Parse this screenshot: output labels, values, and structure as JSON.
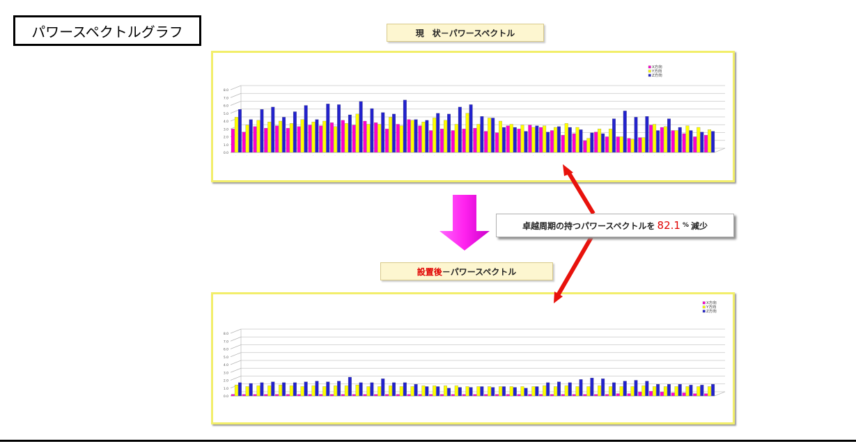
{
  "page": {
    "title": "パワースペクトルグラフ"
  },
  "top_chart": {
    "label": "現　状－パワースペクトル"
  },
  "bottom_chart": {
    "label_highlight": "設置後",
    "label_rest": "－パワースペクトル"
  },
  "callout": {
    "prefix": "卓越周期の持つパワースペクトルを",
    "value": "82.1",
    "percent": "%",
    "suffix": "減少"
  },
  "colors": {
    "x_series": "#ff00cc",
    "y_series": "#ffff00",
    "z_series": "#2222cc",
    "down_arrow": "#ff33ff",
    "red_arrow": "#e8120c",
    "frame_border": "#f2ee6a"
  },
  "chart_data": [
    {
      "type": "bar",
      "ylim": [
        0,
        8
      ],
      "yticks": [
        "0.0",
        "1.0",
        "2.0",
        "3.0",
        "4.0",
        "5.0",
        "6.0",
        "7.0",
        "8.0"
      ],
      "legend_position": "top-right",
      "series": [
        {
          "name": "X方向",
          "color": "#ff00cc",
          "values": [
            3.0,
            2.6,
            3.3,
            3.1,
            3.4,
            3.1,
            3.3,
            3.5,
            3.4,
            3.8,
            4.1,
            3.5,
            4.0,
            3.8,
            3.0,
            3.6,
            4.2,
            3.4,
            2.8,
            3.0,
            2.8,
            3.0,
            3.1,
            2.7,
            2.5,
            3.4,
            3.0,
            3.5,
            3.2,
            2.8,
            2.2,
            2.4,
            1.5,
            2.6,
            2.0,
            2.0,
            1.8,
            1.9,
            3.5,
            3.2,
            2.8,
            2.4,
            2.0,
            2.2
          ]
        },
        {
          "name": "Y方向",
          "color": "#ffff00",
          "values": [
            4.5,
            3.5,
            4.1,
            3.9,
            4.0,
            3.7,
            4.2,
            3.9,
            4.0,
            3.3,
            3.7,
            4.9,
            3.6,
            3.6,
            4.5,
            3.4,
            4.1,
            3.9,
            4.4,
            4.1,
            3.6,
            5.0,
            3.6,
            4.4,
            4.0,
            3.6,
            3.5,
            3.2,
            3.4,
            3.2,
            3.7,
            3.2,
            1.8,
            3.0,
            3.0,
            2.0,
            1.7,
            1.9,
            3.6,
            3.3,
            2.8,
            3.4,
            3.2,
            2.9
          ]
        },
        {
          "name": "Z方向",
          "color": "#2222cc",
          "values": [
            5.5,
            4.2,
            5.5,
            5.8,
            4.5,
            5.2,
            6.0,
            4.2,
            6.2,
            6.1,
            4.8,
            6.5,
            5.6,
            5.1,
            4.9,
            6.7,
            4.2,
            4.1,
            5.0,
            4.9,
            5.8,
            6.1,
            4.6,
            4.4,
            3.2,
            3.2,
            2.7,
            3.4,
            2.6,
            3.3,
            3.2,
            2.9,
            2.5,
            2.4,
            4.3,
            5.3,
            4.5,
            4.6,
            2.8,
            4.3,
            3.2,
            2.8,
            2.6,
            2.7
          ]
        }
      ]
    },
    {
      "type": "bar",
      "ylim": [
        0,
        8
      ],
      "yticks": [
        "0.0",
        "1.0",
        "2.0",
        "3.0",
        "4.0",
        "5.0",
        "6.0",
        "7.0",
        "8.0"
      ],
      "legend_position": "top-right",
      "series": [
        {
          "name": "X方向",
          "color": "#ff00cc",
          "values": [
            0.2,
            0.2,
            0.2,
            0.2,
            0.2,
            0.2,
            0.2,
            0.2,
            0.2,
            0.2,
            0.2,
            0.2,
            0.2,
            0.2,
            0.2,
            0.2,
            0.2,
            0.2,
            0.2,
            0.2,
            0.2,
            0.2,
            0.2,
            0.2,
            0.2,
            0.2,
            0.2,
            0.2,
            0.2,
            0.2,
            0.2,
            0.2,
            0.2,
            0.2,
            0.2,
            0.3,
            0.3,
            0.5,
            0.6,
            0.5,
            0.4,
            0.4,
            0.3,
            0.3
          ]
        },
        {
          "name": "Y方向",
          "color": "#ffff00",
          "values": [
            1.4,
            1.2,
            1.3,
            1.3,
            1.4,
            1.3,
            1.2,
            1.3,
            1.2,
            1.3,
            1.3,
            1.4,
            1.2,
            1.2,
            1.3,
            1.2,
            1.2,
            1.3,
            1.3,
            1.3,
            1.3,
            1.2,
            1.2,
            1.2,
            1.2,
            1.2,
            1.2,
            1.2,
            1.3,
            1.2,
            1.3,
            1.2,
            1.2,
            1.3,
            1.2,
            1.2,
            1.2,
            1.3,
            1.2,
            1.2,
            1.2,
            1.2,
            1.2,
            1.2
          ]
        },
        {
          "name": "Z方向",
          "color": "#2222cc",
          "values": [
            1.7,
            1.6,
            1.7,
            1.8,
            1.7,
            1.7,
            1.8,
            1.9,
            1.8,
            1.9,
            2.4,
            1.7,
            1.7,
            2.2,
            1.7,
            1.7,
            1.5,
            1.2,
            1.2,
            1.0,
            1.1,
            1.1,
            1.2,
            1.1,
            1.2,
            1.1,
            1.0,
            1.2,
            1.7,
            1.8,
            1.7,
            2.1,
            2.3,
            2.2,
            1.7,
            1.9,
            2.0,
            1.9,
            1.5,
            1.5,
            1.5,
            1.4,
            1.4,
            1.5
          ]
        }
      ]
    }
  ]
}
